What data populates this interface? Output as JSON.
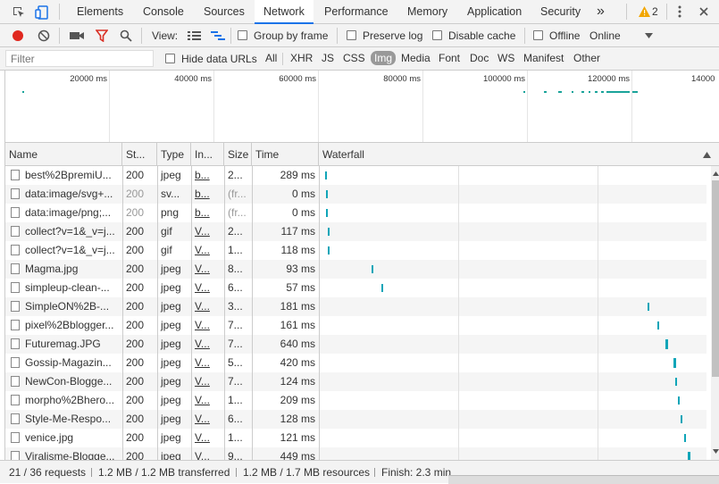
{
  "tabs": {
    "elements": "Elements",
    "console": "Console",
    "sources": "Sources",
    "network": "Network",
    "performance": "Performance",
    "memory": "Memory",
    "application": "Application",
    "security": "Security",
    "more": "»",
    "warning_count": "2"
  },
  "toolbar": {
    "view_label": "View:",
    "group_by_frame": "Group by frame",
    "preserve_log": "Preserve log",
    "disable_cache": "Disable cache",
    "offline": "Offline",
    "throttle": "Online"
  },
  "filter": {
    "placeholder": "Filter",
    "hide_data_urls": "Hide data URLs",
    "types": [
      "All",
      "XHR",
      "JS",
      "CSS",
      "Img",
      "Media",
      "Font",
      "Doc",
      "WS",
      "Manifest",
      "Other"
    ],
    "active_type": "Img"
  },
  "overview": {
    "ticks": [
      "20000 ms",
      "40000 ms",
      "60000 ms",
      "80000 ms",
      "100000 ms",
      "120000 ms",
      "14000"
    ]
  },
  "columns": {
    "name": "Name",
    "status": "St...",
    "type": "Type",
    "initiator": "In...",
    "size": "Size",
    "time": "Time",
    "waterfall": "Waterfall"
  },
  "rows": [
    {
      "name": "best%2BpremiU...",
      "status": "200",
      "type": "jpeg",
      "initiator": "b...",
      "size": "2...",
      "time": "289 ms",
      "dim": false,
      "wf": 0.008
    },
    {
      "name": "data:image/svg+...",
      "status": "200",
      "type": "sv...",
      "initiator": "b...",
      "size": "(fr...",
      "time": "0 ms",
      "dim": true,
      "wf": 0.009
    },
    {
      "name": "data:image/png;...",
      "status": "200",
      "type": "png",
      "initiator": "b...",
      "size": "(fr...",
      "time": "0 ms",
      "dim": true,
      "wf": 0.009
    },
    {
      "name": "collect?v=1&_v=j...",
      "status": "200",
      "type": "gif",
      "initiator": "V...",
      "size": "2...",
      "time": "117 ms",
      "dim": false,
      "wf": 0.014
    },
    {
      "name": "collect?v=1&_v=j...",
      "status": "200",
      "type": "gif",
      "initiator": "V...",
      "size": "1...",
      "time": "118 ms",
      "dim": false,
      "wf": 0.014
    },
    {
      "name": "Magma.jpg",
      "status": "200",
      "type": "jpeg",
      "initiator": "V...",
      "size": "8...",
      "time": "93 ms",
      "dim": false,
      "wf": 0.129
    },
    {
      "name": "simpleup-clean-...",
      "status": "200",
      "type": "jpeg",
      "initiator": "V...",
      "size": "6...",
      "time": "57 ms",
      "dim": false,
      "wf": 0.154
    },
    {
      "name": "SimpleON%2B-...",
      "status": "200",
      "type": "jpeg",
      "initiator": "V...",
      "size": "3...",
      "time": "181 ms",
      "dim": false,
      "wf": 0.846
    },
    {
      "name": "pixel%2Bblogger...",
      "status": "200",
      "type": "jpeg",
      "initiator": "V...",
      "size": "7...",
      "time": "161 ms",
      "dim": false,
      "wf": 0.871
    },
    {
      "name": "Futuremag.JPG",
      "status": "200",
      "type": "jpeg",
      "initiator": "V...",
      "size": "7...",
      "time": "640 ms",
      "dim": false,
      "wf": 0.894
    },
    {
      "name": "Gossip-Magazin...",
      "status": "200",
      "type": "jpeg",
      "initiator": "V...",
      "size": "5...",
      "time": "420 ms",
      "dim": false,
      "wf": 0.913
    },
    {
      "name": "NewCon-Blogge...",
      "status": "200",
      "type": "jpeg",
      "initiator": "V...",
      "size": "7...",
      "time": "124 ms",
      "dim": false,
      "wf": 0.918
    },
    {
      "name": "morpho%2Bhero...",
      "status": "200",
      "type": "jpeg",
      "initiator": "V...",
      "size": "1...",
      "time": "209 ms",
      "dim": false,
      "wf": 0.925
    },
    {
      "name": "Style-Me-Respo...",
      "status": "200",
      "type": "jpeg",
      "initiator": "V...",
      "size": "6...",
      "time": "128 ms",
      "dim": false,
      "wf": 0.932
    },
    {
      "name": "venice.jpg",
      "status": "200",
      "type": "jpeg",
      "initiator": "V...",
      "size": "1...",
      "time": "121 ms",
      "dim": false,
      "wf": 0.941
    },
    {
      "name": "Viralisme-Blogge...",
      "status": "200",
      "type": "jpeg",
      "initiator": "V...",
      "size": "9...",
      "time": "449 ms",
      "dim": false,
      "wf": 0.952
    }
  ],
  "status": {
    "requests": "21 / 36 requests",
    "transferred": "1.2 MB / 1.2 MB transferred",
    "resources": "1.2 MB / 1.7 MB resources",
    "finish": "Finish: 2.3 min"
  },
  "colors": {
    "accent": "#1a73e8",
    "record": "#e0281f",
    "filter_active": "#d93025",
    "waterfall": "#10a5b8",
    "warning": "#f2a600"
  }
}
